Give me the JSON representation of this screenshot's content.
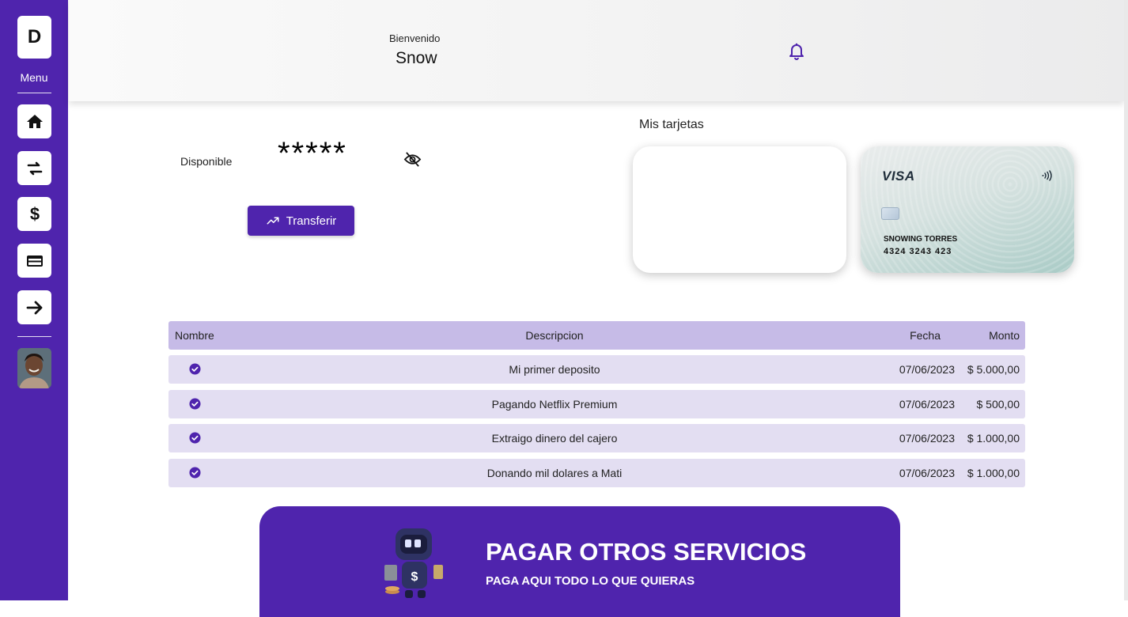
{
  "sidebar": {
    "logo_letter": "D",
    "menu_label": "Menu",
    "nav_items": [
      "home-icon",
      "swap-icon",
      "dollar-icon",
      "credit-card-icon",
      "arrow-right-icon"
    ]
  },
  "header": {
    "welcome": "Bienvenido",
    "username": "Snow"
  },
  "balance": {
    "label": "Disponible",
    "hidden_value": "*****",
    "transfer_label": "Transferir"
  },
  "cards": {
    "title": "Mis tarjetas",
    "visa": {
      "brand": "VISA",
      "holder": "SNOWING TORRES",
      "number": "4324 3243 423"
    }
  },
  "transactions": {
    "headers": {
      "name": "Nombre",
      "description": "Descripcion",
      "date": "Fecha",
      "amount": "Monto"
    },
    "rows": [
      {
        "description": "Mi primer deposito",
        "date": "07/06/2023",
        "amount": "$ 5.000,00"
      },
      {
        "description": "Pagando Netflix Premium",
        "date": "07/06/2023",
        "amount": "$ 500,00"
      },
      {
        "description": "Extraigo dinero del cajero",
        "date": "07/06/2023",
        "amount": "$ 1.000,00"
      },
      {
        "description": "Donando mil dolares a Mati",
        "date": "07/06/2023",
        "amount": "$ 1.000,00"
      }
    ]
  },
  "promo": {
    "title": "PAGAR OTROS SERVICIOS",
    "subtitle": "PAGA AQUI TODO LO QUE QUIERAS"
  },
  "colors": {
    "primary": "#4f24ad",
    "table_header": "#c6bbe7",
    "table_row": "#e3def2"
  }
}
